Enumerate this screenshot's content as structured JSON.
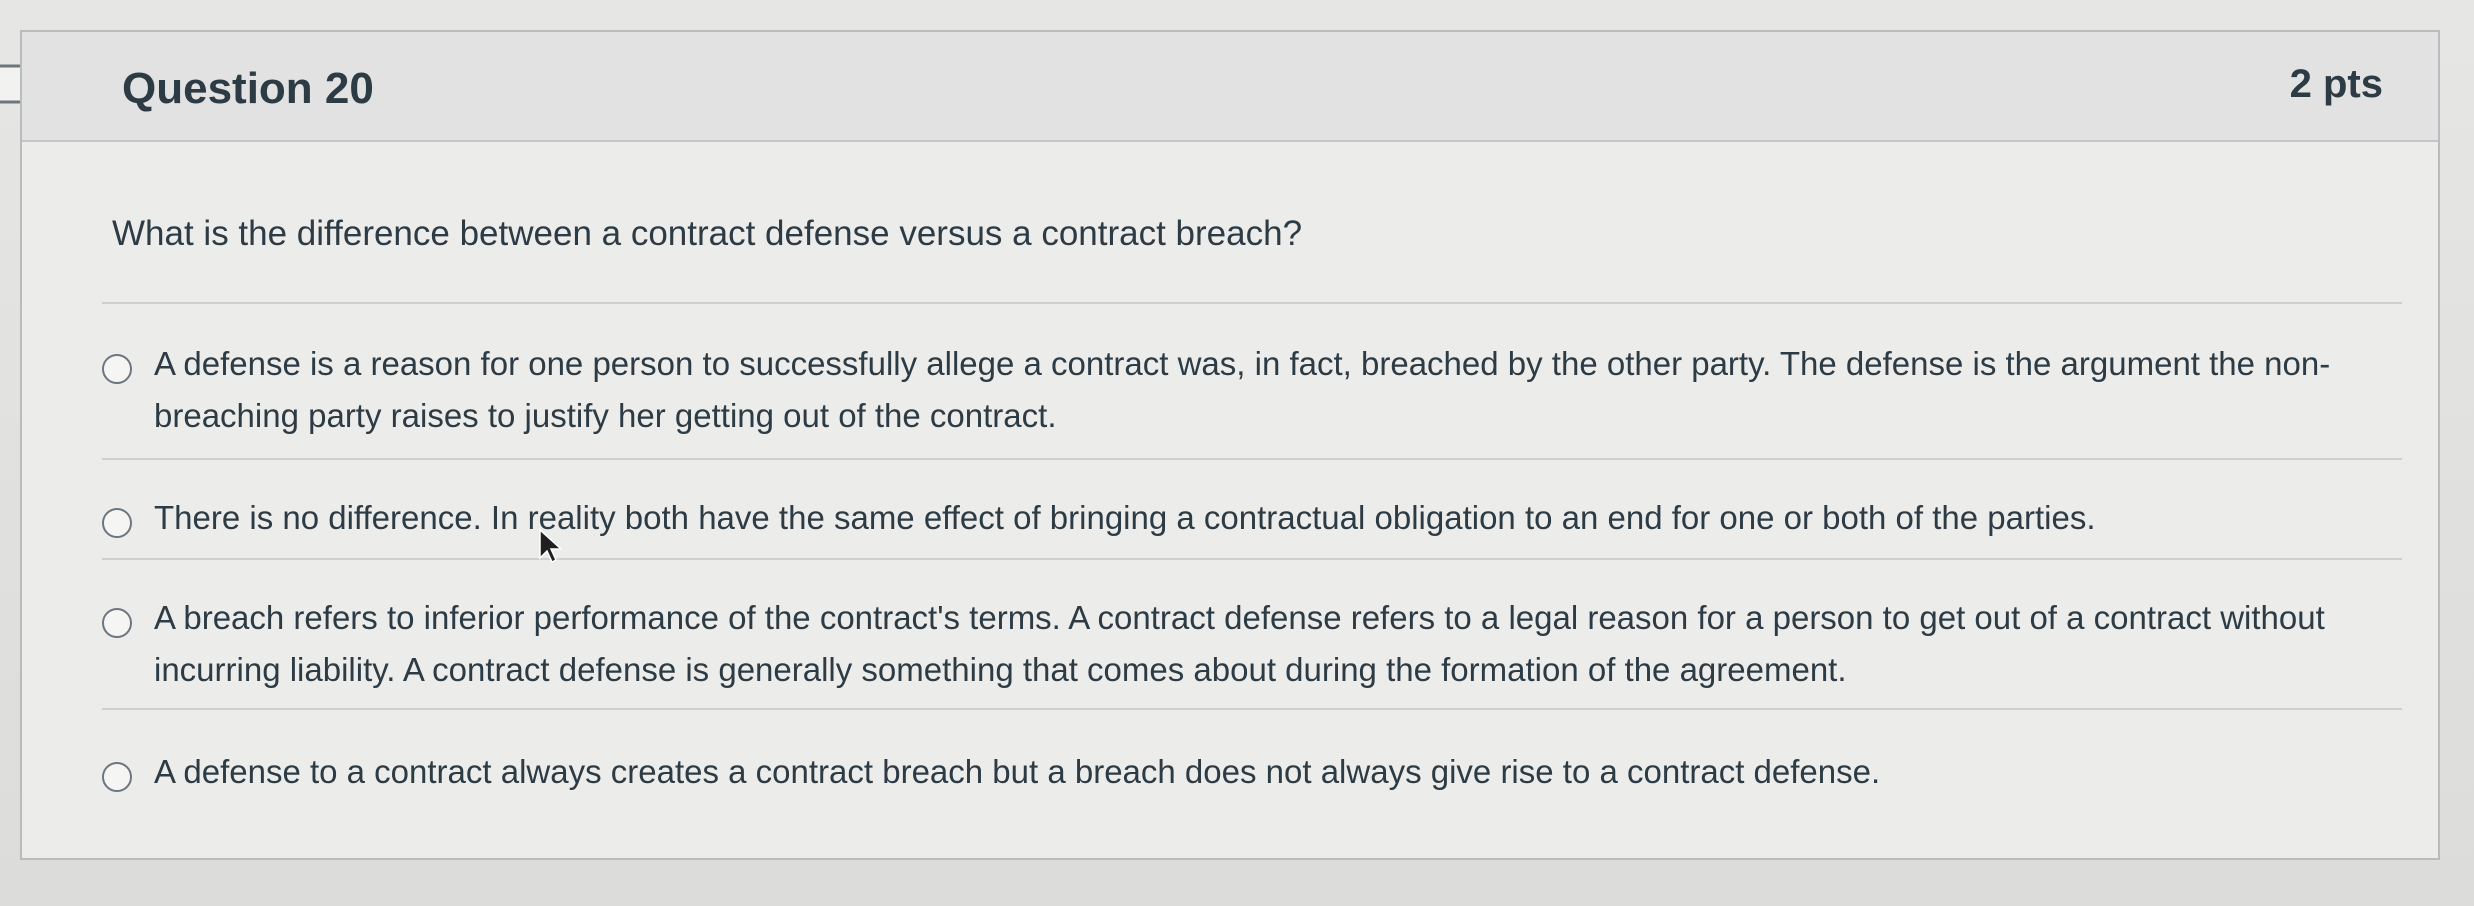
{
  "question": {
    "title": "Question 20",
    "points": "2 pts",
    "text": "What is the difference between a contract defense versus a contract breach?"
  },
  "answers": [
    {
      "text": "A defense is a reason for one person to successfully allege a contract was, in fact, breached by the other party.  The defense is the argument the non-breaching party raises to justify her getting out of the contract."
    },
    {
      "text": "There is no difference.  In reality both have the same effect of bringing a contractual obligation to an end for one or both of the parties."
    },
    {
      "text": "A breach refers to inferior performance of the contract's terms.  A contract defense refers to a legal reason for a person to get out of a contract without incurring liability.  A contract defense is generally something that comes about during the formation of the agreement."
    },
    {
      "text": "A defense to a contract always creates a contract breach but a breach does not always give rise to a contract defense."
    }
  ],
  "icons": {
    "flag": "flag-icon",
    "cursor": "mouse-pointer-icon"
  },
  "colors": {
    "text": "#2d3b45",
    "header_bg": "#e1e2e1",
    "border": "#b9bcbd"
  }
}
